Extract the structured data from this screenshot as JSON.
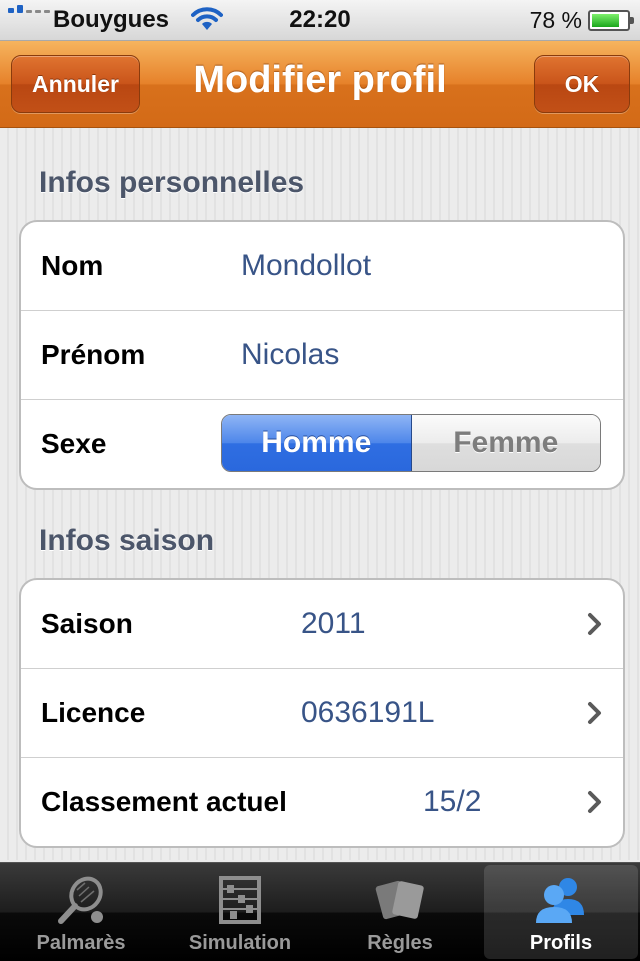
{
  "status_bar": {
    "carrier": "Bouygues",
    "time": "22:20",
    "battery": "78 %",
    "battery_level": 0.78
  },
  "navbar": {
    "title": "Modifier profil",
    "cancel_label": "Annuler",
    "ok_label": "OK"
  },
  "personal": {
    "header": "Infos personnelles",
    "nom_label": "Nom",
    "nom_value": "Mondollot",
    "prenom_label": "Prénom",
    "prenom_value": "Nicolas",
    "sexe_label": "Sexe",
    "sexe_options": [
      "Homme",
      "Femme"
    ],
    "sexe_selected": "Homme"
  },
  "season": {
    "header": "Infos saison",
    "saison_label": "Saison",
    "saison_value": "2011",
    "licence_label": "Licence",
    "licence_value": "0636191L",
    "classement_label": "Classement actuel",
    "classement_value": "15/2"
  },
  "tabbar": {
    "tabs": [
      {
        "label": "Palmarès",
        "icon": "tennis-racket-icon"
      },
      {
        "label": "Simulation",
        "icon": "abacus-icon"
      },
      {
        "label": "Règles",
        "icon": "cards-icon"
      },
      {
        "label": "Profils",
        "icon": "users-icon"
      }
    ],
    "active": "Profils"
  },
  "colors": {
    "navbar_orange": "#e6812a",
    "value_blue": "#385487",
    "segment_selected": "#2f6ee2"
  }
}
